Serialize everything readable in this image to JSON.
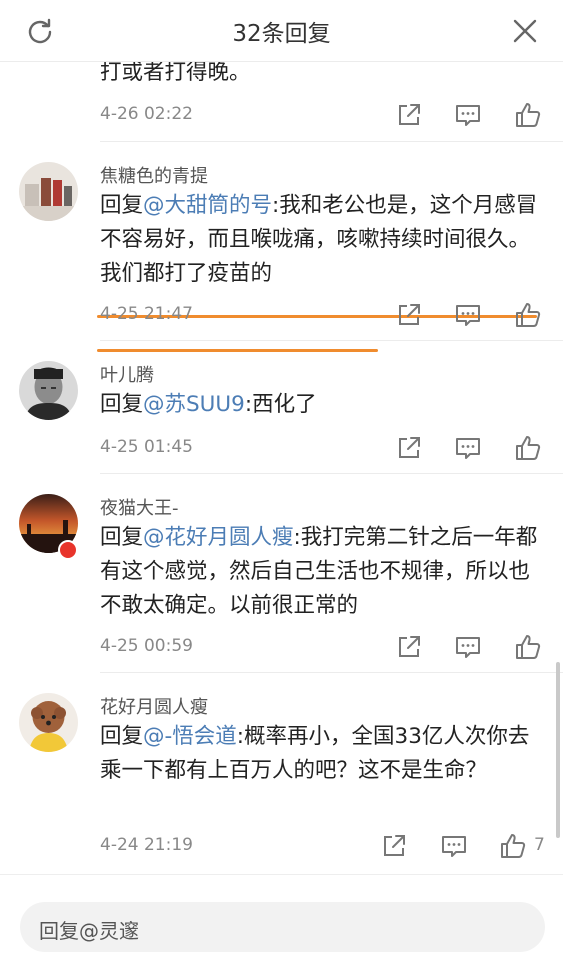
{
  "header": {
    "title": "32条回复"
  },
  "comments": [
    {
      "username": "",
      "content_rest": "打或者打得晚。",
      "time": "4-26 02:22"
    },
    {
      "username": "焦糖色的青提",
      "reply_prefix": "回复",
      "mention": "@大甜筒的号",
      "content_rest": ":我和老公也是，这个月感冒不容易好，而且喉咙痛，咳嗽持续时间很久。我们都打了疫苗的",
      "time": "4-25 21:47"
    },
    {
      "username": "叶儿腾",
      "reply_prefix": "回复",
      "mention": "@苏SUU9",
      "content_rest": ":西化了",
      "time": "4-25 01:45"
    },
    {
      "username": "夜猫大王-",
      "reply_prefix": "回复",
      "mention": "@花好月圆人瘦",
      "content_rest": ":我打完第二针之后一年都有这个感觉，然后自己生活也不规律，所以也不敢太确定。以前很正常的",
      "time": "4-25 00:59"
    },
    {
      "username": "花好月圆人瘦",
      "reply_prefix": "回复",
      "mention": "@-悟会道",
      "content_rest": ":概率再小，全国33亿人次你去乘一下都有上百万人的吧？这不是生命？",
      "time": "4-24 21:19",
      "like_count": "7"
    }
  ],
  "reply_input": {
    "placeholder": "回复@灵邃"
  },
  "icons": {
    "refresh": "refresh-icon",
    "close": "close-icon",
    "share": "share-icon",
    "comment": "comment-icon",
    "like": "thumbs-up-icon"
  },
  "colors": {
    "mention": "#4c7db5",
    "underline": "#f08c2e",
    "verified_badge": "#e8342b"
  }
}
